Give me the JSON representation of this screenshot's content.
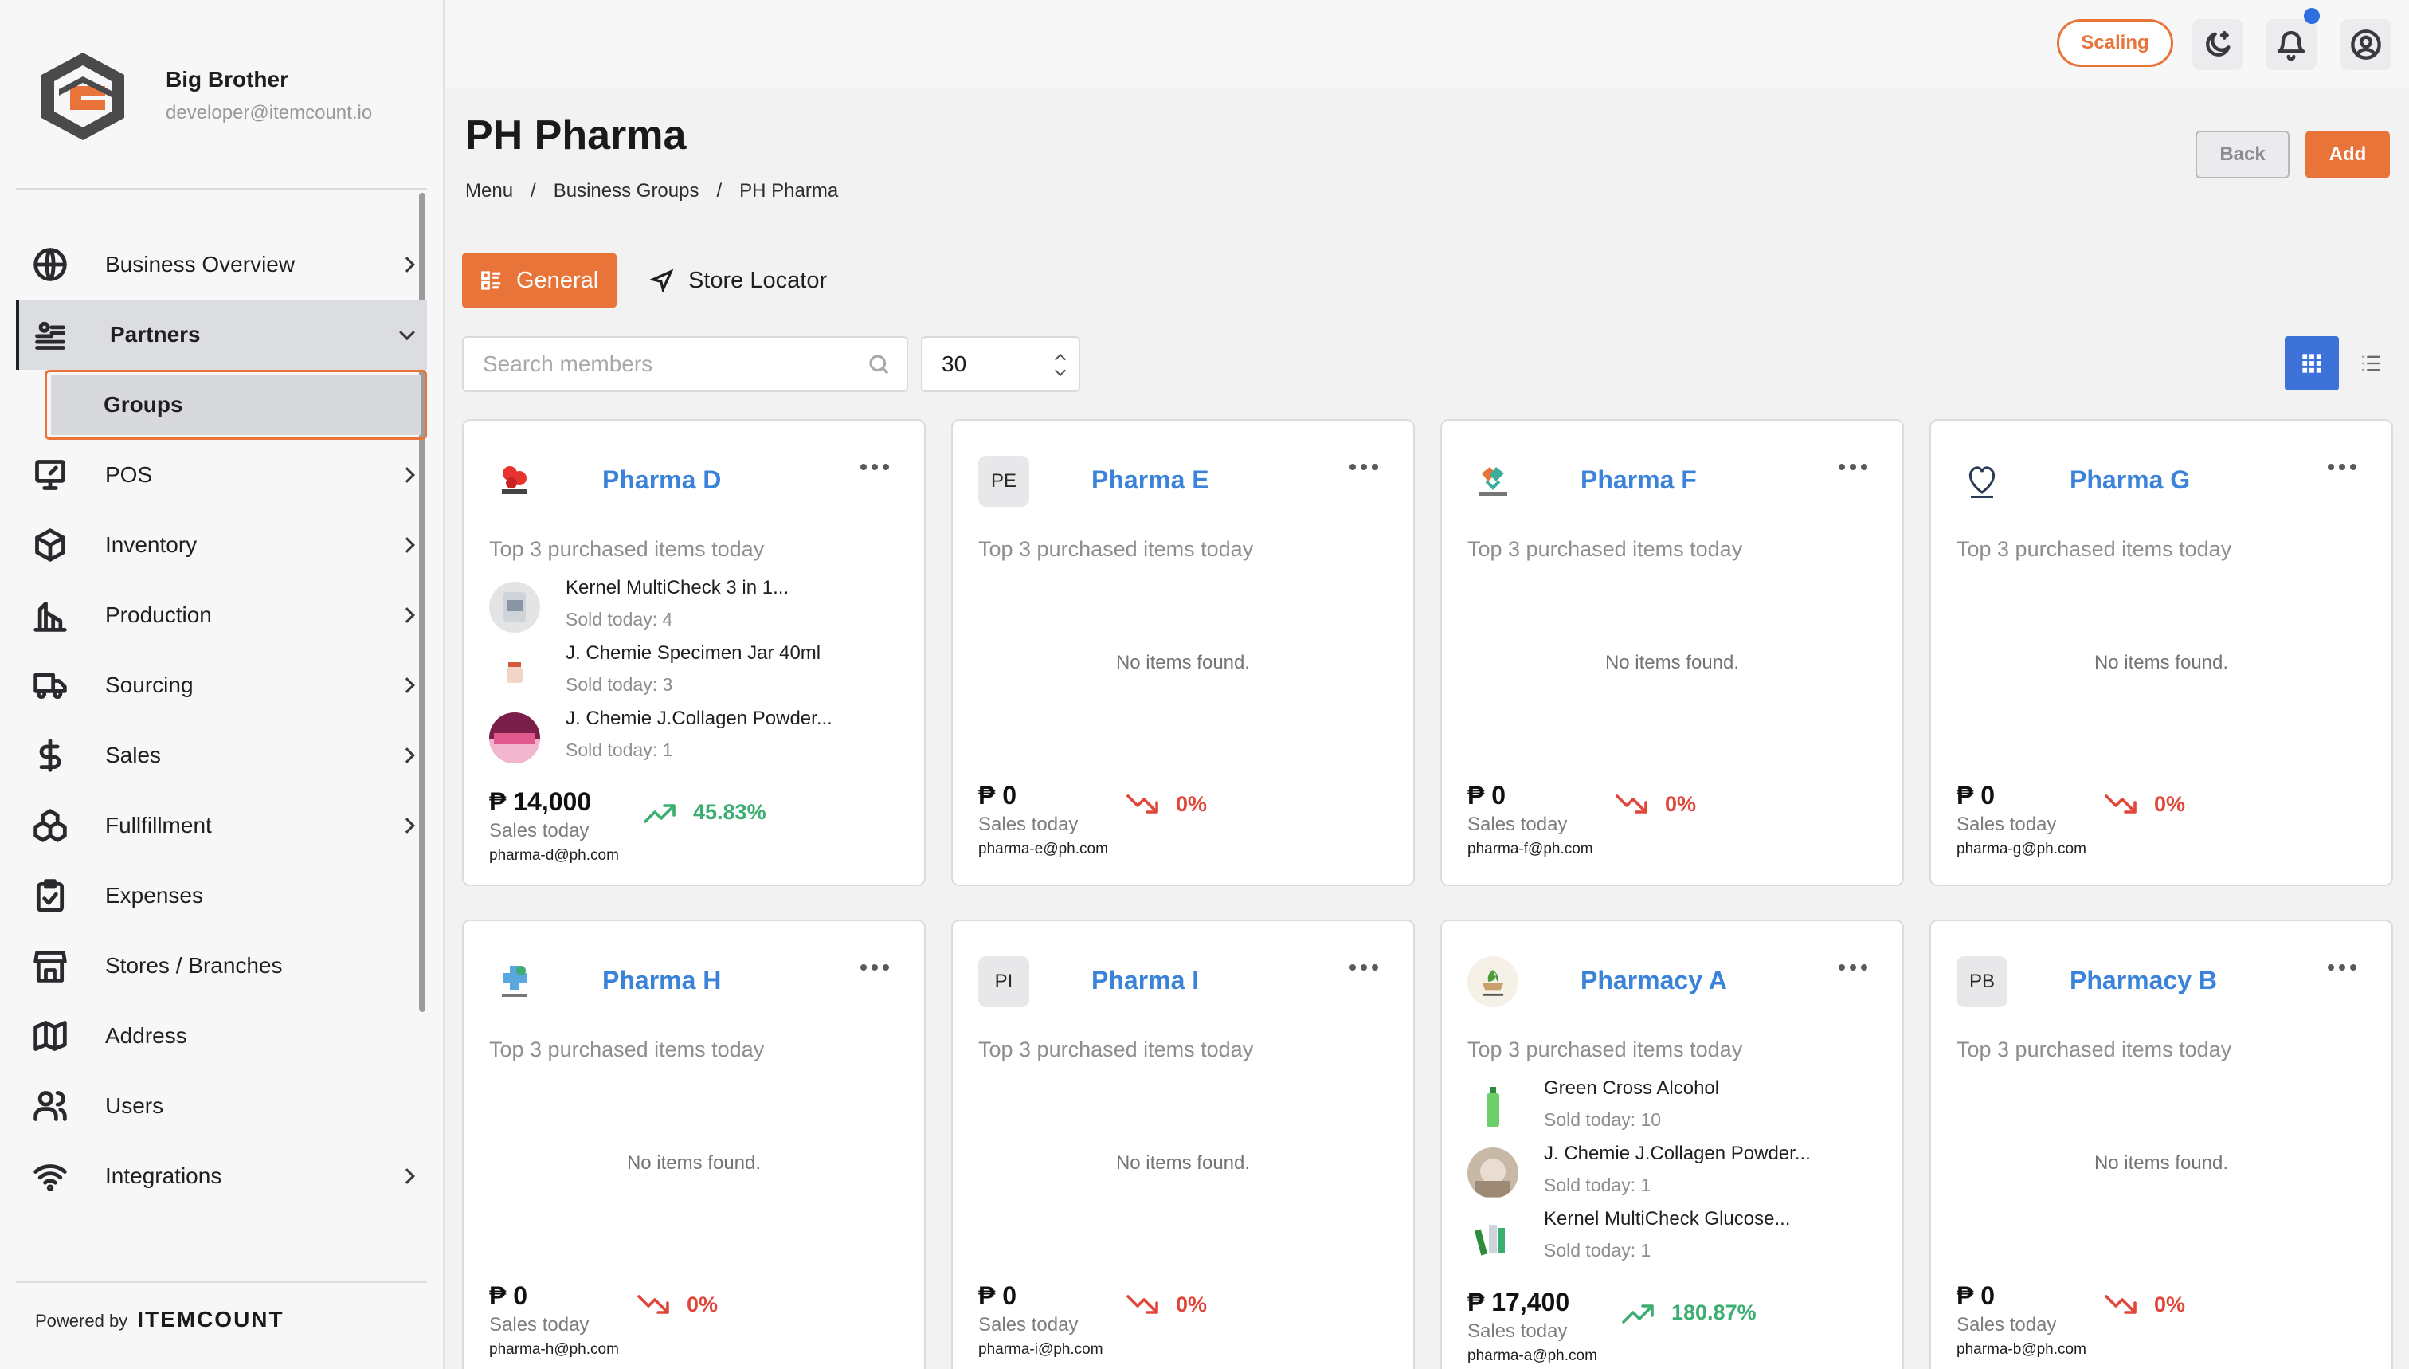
{
  "brand": {
    "name": "Big Brother",
    "email": "developer@itemcount.io"
  },
  "sidebar": {
    "items": [
      {
        "label": "Business Overview",
        "icon": "globe-icon",
        "chevron": true
      },
      {
        "label": "Partners",
        "icon": "partners-icon",
        "chevron": true,
        "active": true
      },
      {
        "label": "POS",
        "icon": "pos-icon",
        "chevron": true
      },
      {
        "label": "Inventory",
        "icon": "box-icon",
        "chevron": true
      },
      {
        "label": "Production",
        "icon": "factory-icon",
        "chevron": true
      },
      {
        "label": "Sourcing",
        "icon": "truck-icon",
        "chevron": true
      },
      {
        "label": "Sales",
        "icon": "dollar-icon",
        "chevron": true
      },
      {
        "label": "Fullfillment",
        "icon": "boxes-icon",
        "chevron": true
      },
      {
        "label": "Expenses",
        "icon": "clipboard-icon",
        "chevron": false
      },
      {
        "label": "Stores / Branches",
        "icon": "store-icon",
        "chevron": false
      },
      {
        "label": "Address",
        "icon": "map-icon",
        "chevron": false
      },
      {
        "label": "Users",
        "icon": "users-icon",
        "chevron": false
      },
      {
        "label": "Integrations",
        "icon": "wifi-icon",
        "chevron": true
      }
    ],
    "subitem": "Groups",
    "powered_label": "Powered by",
    "powered_brand": "ITEMCOUNT"
  },
  "header": {
    "scaling": "Scaling"
  },
  "page": {
    "title": "PH Pharma",
    "breadcrumb": [
      "Menu",
      "/",
      "Business Groups",
      "/",
      "PH Pharma"
    ],
    "back": "Back",
    "add": "Add",
    "tabs": {
      "general": "General",
      "locator": "Store Locator"
    },
    "search_placeholder": "Search members",
    "page_size": "30"
  },
  "cards": [
    {
      "name": "Pharma D",
      "avatar": "logo",
      "initials": "",
      "subtitle": "Top 3 purchased items today",
      "items": [
        {
          "name": "Kernel MultiCheck 3 in 1...",
          "sold": "Sold today: 4"
        },
        {
          "name": "J. Chemie Specimen Jar 40ml",
          "sold": "Sold today: 3"
        },
        {
          "name": "J. Chemie J.Collagen Powder...",
          "sold": "Sold today: 1"
        }
      ],
      "amount": "₱ 14,000",
      "sales_label": "Sales today",
      "trend": "45.83%",
      "trend_dir": "up",
      "email": "pharma-d@ph.com"
    },
    {
      "name": "Pharma E",
      "avatar": "initials",
      "initials": "PE",
      "subtitle": "Top 3 purchased items today",
      "empty": "No items found.",
      "amount": "₱ 0",
      "sales_label": "Sales today",
      "trend": "0%",
      "trend_dir": "down",
      "email": "pharma-e@ph.com"
    },
    {
      "name": "Pharma F",
      "avatar": "logo",
      "initials": "",
      "subtitle": "Top 3 purchased items today",
      "empty": "No items found.",
      "amount": "₱ 0",
      "sales_label": "Sales today",
      "trend": "0%",
      "trend_dir": "down",
      "email": "pharma-f@ph.com"
    },
    {
      "name": "Pharma G",
      "avatar": "logo",
      "initials": "",
      "subtitle": "Top 3 purchased items today",
      "empty": "No items found.",
      "amount": "₱ 0",
      "sales_label": "Sales today",
      "trend": "0%",
      "trend_dir": "down",
      "email": "pharma-g@ph.com"
    },
    {
      "name": "Pharma H",
      "avatar": "logo",
      "initials": "",
      "subtitle": "Top 3 purchased items today",
      "empty": "No items found.",
      "amount": "₱ 0",
      "sales_label": "Sales today",
      "trend": "0%",
      "trend_dir": "down",
      "email": "pharma-h@ph.com"
    },
    {
      "name": "Pharma I",
      "avatar": "initials",
      "initials": "PI",
      "subtitle": "Top 3 purchased items today",
      "empty": "No items found.",
      "amount": "₱ 0",
      "sales_label": "Sales today",
      "trend": "0%",
      "trend_dir": "down",
      "email": "pharma-i@ph.com"
    },
    {
      "name": "Pharmacy A",
      "avatar": "logo",
      "initials": "",
      "subtitle": "Top 3 purchased items today",
      "items": [
        {
          "name": "Green Cross Alcohol",
          "sold": "Sold today: 10"
        },
        {
          "name": "J. Chemie J.Collagen Powder...",
          "sold": "Sold today: 1"
        },
        {
          "name": "Kernel MultiCheck Glucose...",
          "sold": "Sold today: 1"
        }
      ],
      "amount": "₱ 17,400",
      "sales_label": "Sales today",
      "trend": "180.87%",
      "trend_dir": "up",
      "email": "pharma-a@ph.com"
    },
    {
      "name": "Pharmacy B",
      "avatar": "initials",
      "initials": "PB",
      "subtitle": "Top 3 purchased items today",
      "empty": "No items found.",
      "amount": "₱ 0",
      "sales_label": "Sales today",
      "trend": "0%",
      "trend_dir": "down",
      "email": "pharma-b@ph.com"
    }
  ],
  "colors": {
    "accent": "#e8743a",
    "link": "#3b82d9",
    "up": "#3cae71",
    "down": "#e0473a",
    "view_active": "#3d72d9"
  }
}
